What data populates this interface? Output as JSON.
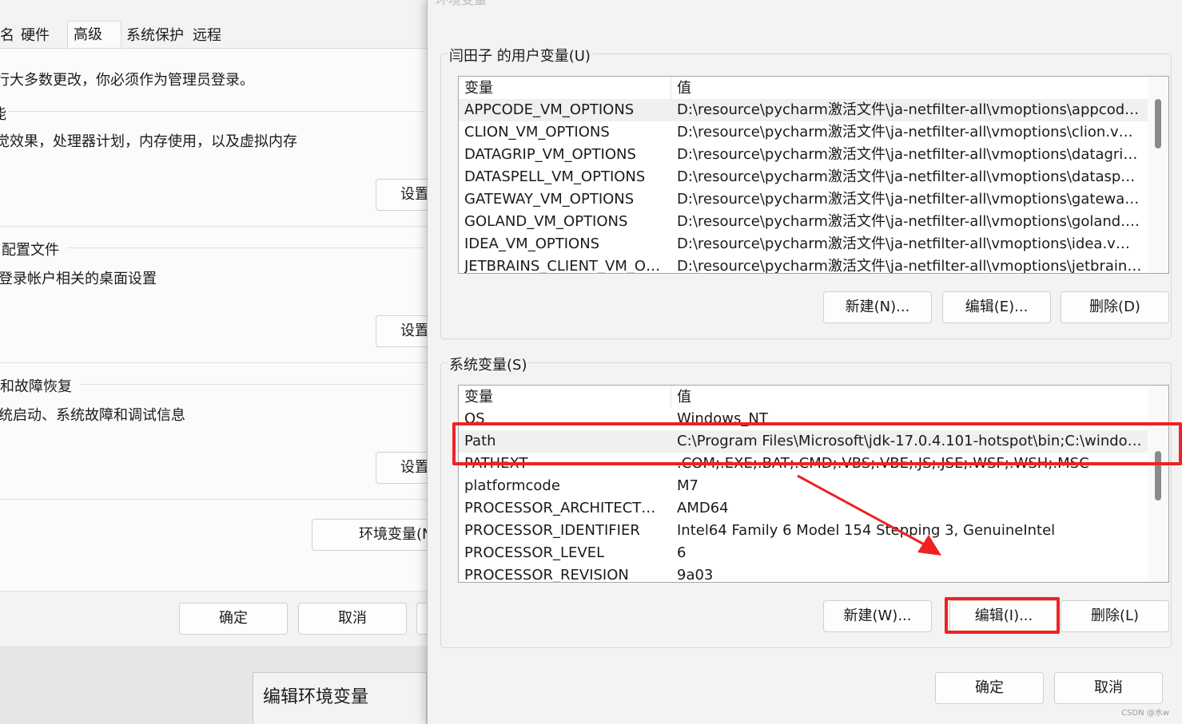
{
  "system_properties": {
    "tabs": [
      {
        "label": "名",
        "active": false
      },
      {
        "label": "硬件",
        "active": false
      },
      {
        "label": "高级",
        "active": true
      },
      {
        "label": "系统保护",
        "active": false
      },
      {
        "label": "远程",
        "active": false
      }
    ],
    "admin_note": "行大多数更改，你必须作为管理员登录。",
    "performance": {
      "group_title": "能",
      "description": "觉效果，处理器计划，内存使用，以及虚拟内存",
      "settings_button": "设置"
    },
    "user_profiles": {
      "group_title": "配置文件",
      "description": "登录帐户相关的桌面设置",
      "settings_button": "设置"
    },
    "startup_recovery": {
      "group_title": "和故障恢复",
      "description": "统启动、系统故障和调试信息",
      "settings_button": "设置"
    },
    "env_vars_button": "环境变量(N",
    "ok_button": "确定",
    "cancel_button": "取消"
  },
  "edit_env_dialog": {
    "title": "编辑环境变量"
  },
  "env_dialog": {
    "title": "环境变量",
    "user_vars": {
      "group_title": "闫田子 的用户变量(U)",
      "col_name": "变量",
      "col_value": "值",
      "rows": [
        {
          "name": "APPCODE_VM_OPTIONS",
          "value": "D:\\resource\\pycharm激活文件\\ja-netfilter-all\\vmoptions\\appcode...",
          "selected": true
        },
        {
          "name": "CLION_VM_OPTIONS",
          "value": "D:\\resource\\pycharm激活文件\\ja-netfilter-all\\vmoptions\\clion.vmo..."
        },
        {
          "name": "DATAGRIP_VM_OPTIONS",
          "value": "D:\\resource\\pycharm激活文件\\ja-netfilter-all\\vmoptions\\datagrip...."
        },
        {
          "name": "DATASPELL_VM_OPTIONS",
          "value": "D:\\resource\\pycharm激活文件\\ja-netfilter-all\\vmoptions\\dataspell...."
        },
        {
          "name": "GATEWAY_VM_OPTIONS",
          "value": "D:\\resource\\pycharm激活文件\\ja-netfilter-all\\vmoptions\\gateway.v..."
        },
        {
          "name": "GOLAND_VM_OPTIONS",
          "value": "D:\\resource\\pycharm激活文件\\ja-netfilter-all\\vmoptions\\goland.v..."
        },
        {
          "name": "IDEA_VM_OPTIONS",
          "value": "D:\\resource\\pycharm激活文件\\ja-netfilter-all\\vmoptions\\idea.vmo..."
        },
        {
          "name": "JETBRAINS_CLIENT_VM_OPT...",
          "value": "D:\\resource\\pycharm激活文件\\ja-netfilter-all\\vmoptions\\jetbrains..."
        }
      ],
      "new_button": "新建(N)...",
      "edit_button": "编辑(E)...",
      "delete_button": "删除(D)"
    },
    "system_vars": {
      "group_title": "系统变量(S)",
      "col_name": "变量",
      "col_value": "值",
      "rows": [
        {
          "name": "OS",
          "value": "Windows_NT"
        },
        {
          "name": "Path",
          "value": "C:\\Program Files\\Microsoft\\jdk-17.0.4.101-hotspot\\bin;C:\\window...",
          "selected": true
        },
        {
          "name": "PATHEXT",
          "value": ".COM;.EXE;.BAT;.CMD;.VBS;.VBE;.JS;.JSE;.WSF;.WSH;.MSC"
        },
        {
          "name": "platformcode",
          "value": "M7"
        },
        {
          "name": "PROCESSOR_ARCHITECTURE",
          "value": "AMD64"
        },
        {
          "name": "PROCESSOR_IDENTIFIER",
          "value": "Intel64 Family 6 Model 154 Stepping 3, GenuineIntel"
        },
        {
          "name": "PROCESSOR_LEVEL",
          "value": "6"
        },
        {
          "name": "PROCESSOR_REVISION",
          "value": "9a03"
        }
      ],
      "new_button": "新建(W)...",
      "edit_button": "编辑(I)...",
      "delete_button": "删除(L)"
    },
    "ok_button": "确定",
    "cancel_button": "取消"
  },
  "annotation": {
    "highlight_color": "#ee2222"
  },
  "watermark": "CSDN @水w"
}
